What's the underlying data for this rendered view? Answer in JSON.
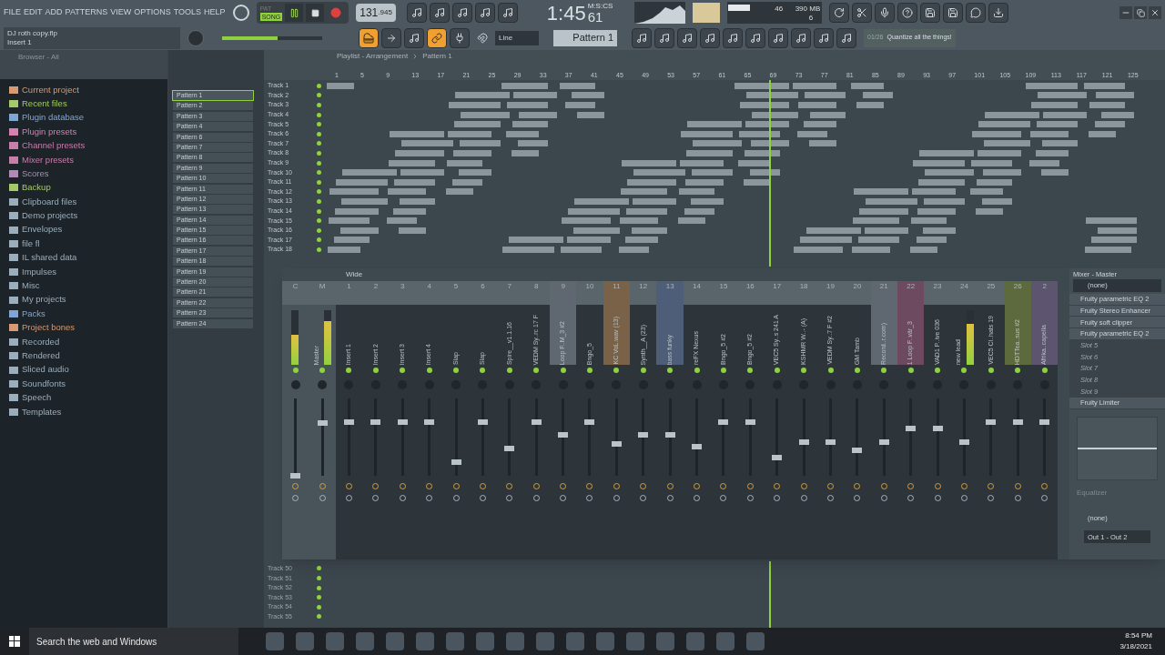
{
  "menu": [
    "FILE",
    "EDIT",
    "ADD",
    "PATTERNS",
    "VIEW",
    "OPTIONS",
    "TOOLS",
    "HELP"
  ],
  "project": {
    "file": "DJ roth copy.flp",
    "hint": "Insert 1"
  },
  "transport": {
    "mode_pat": "PAT",
    "mode_song": "SONG",
    "song_selected": true,
    "playing": true,
    "tempo": "131",
    "tempo_frac": ".945",
    "time": "1:45",
    "time_cs": "61",
    "time_unit": "M:S:CS",
    "main_volume": {
      "level": 0.55
    }
  },
  "cpu": {
    "value": "46",
    "memory": "390 MB",
    "voices": "6"
  },
  "snap": "Line",
  "pattern": "Pattern 1",
  "hint_bar": {
    "counter": "01/26",
    "text": "Quantize all the things!"
  },
  "browser": {
    "title": "Browser - All",
    "items": [
      {
        "label": "Current project",
        "color": "#d79a72"
      },
      {
        "label": "Recent files",
        "color": "#a6c96a"
      },
      {
        "label": "Plugin database",
        "color": "#7fa5d6"
      },
      {
        "label": "Plugin presets",
        "color": "#d77fb0"
      },
      {
        "label": "Channel presets",
        "color": "#c77faa"
      },
      {
        "label": "Mixer presets",
        "color": "#c77faa"
      },
      {
        "label": "Scores",
        "color": "#b18ab8"
      },
      {
        "label": "Backup",
        "color": "#a6c96a"
      },
      {
        "label": "Clipboard files",
        "color": "#9aaebb"
      },
      {
        "label": "Demo projects",
        "color": "#9aaebb"
      },
      {
        "label": "Envelopes",
        "color": "#9aaebb"
      },
      {
        "label": "file fl",
        "color": "#9aaebb"
      },
      {
        "label": "IL shared data",
        "color": "#9aaebb"
      },
      {
        "label": "Impulses",
        "color": "#9aaebb"
      },
      {
        "label": "Misc",
        "color": "#9aaebb"
      },
      {
        "label": "My projects",
        "color": "#9aaebb"
      },
      {
        "label": "Packs",
        "color": "#7fa5d6"
      },
      {
        "label": "Project bones",
        "color": "#d79a72"
      },
      {
        "label": "Recorded",
        "color": "#9aaebb"
      },
      {
        "label": "Rendered",
        "color": "#9aaebb"
      },
      {
        "label": "Sliced audio",
        "color": "#9aaebb"
      },
      {
        "label": "Soundfonts",
        "color": "#9aaebb"
      },
      {
        "label": "Speech",
        "color": "#9aaebb"
      },
      {
        "label": "Templates",
        "color": "#9aaebb"
      }
    ]
  },
  "patterns": [
    {
      "label": "Pattern 1",
      "selected": true
    },
    {
      "label": "Pattern 2",
      "selected": false
    },
    {
      "label": "Pattern 3",
      "selected": false
    },
    {
      "label": "Pattern 4",
      "selected": false
    },
    {
      "label": "Pattern 6",
      "selected": false
    },
    {
      "label": "Pattern 7",
      "selected": false
    },
    {
      "label": "Pattern 8",
      "selected": false
    },
    {
      "label": "Pattern 9",
      "selected": false
    },
    {
      "label": "Pattern 10",
      "selected": false
    },
    {
      "label": "Pattern 11",
      "selected": false
    },
    {
      "label": "Pattern 12",
      "selected": false
    },
    {
      "label": "Pattern 13",
      "selected": false
    },
    {
      "label": "Pattern 14",
      "selected": false
    },
    {
      "label": "Pattern 15",
      "selected": false
    },
    {
      "label": "Pattern 16",
      "selected": false
    },
    {
      "label": "Pattern 17",
      "selected": false
    },
    {
      "label": "Pattern 18",
      "selected": false
    },
    {
      "label": "Pattern 19",
      "selected": false
    },
    {
      "label": "Pattern 20",
      "selected": false
    },
    {
      "label": "Pattern 21",
      "selected": false
    },
    {
      "label": "Pattern 22",
      "selected": false
    },
    {
      "label": "Pattern 23",
      "selected": false
    },
    {
      "label": "Pattern 24",
      "selected": false
    }
  ],
  "playlist": {
    "title": "Playlist - Arrangement",
    "pattern": "Pattern 1",
    "ruler": [
      "1",
      "5",
      "9",
      "13",
      "17",
      "21",
      "25",
      "29",
      "33",
      "37",
      "41",
      "45",
      "49",
      "53",
      "57",
      "61",
      "65",
      "69",
      "73",
      "77",
      "81",
      "85",
      "89",
      "93",
      "97",
      "101",
      "105",
      "109",
      "113",
      "117",
      "121",
      "125"
    ],
    "tracks": [
      "Track 1",
      "Track 2",
      "Track 3",
      "Track 4",
      "Track 5",
      "Track 6",
      "Track 7",
      "Track 8",
      "Track 9",
      "Track 10",
      "Track 11",
      "Track 12",
      "Track 13",
      "Track 14",
      "Track 15",
      "Track 16",
      "Track 17",
      "Track 18"
    ],
    "lower_tracks": [
      "Track 50",
      "Track 51",
      "Track 52",
      "Track 53",
      "Track 54",
      "Track 55"
    ]
  },
  "mixer": {
    "view": "Wide",
    "channels": [
      {
        "number": "C",
        "level": 0,
        "meter": {
          "level": 0.55
        }
      },
      {
        "number": "M",
        "name": "Master",
        "level": 0.68,
        "meter": {
          "level": 0.8
        }
      },
      {
        "number": "1",
        "name": "Insert 1",
        "level": 0.7
      },
      {
        "number": "2",
        "name": "Insert 2",
        "level": 0.7
      },
      {
        "number": "3",
        "name": "Insert 3",
        "level": 0.7
      },
      {
        "number": "4",
        "name": "Insert 4",
        "level": 0.7
      },
      {
        "number": "5",
        "name": "Slap",
        "level": 0.18
      },
      {
        "number": "6",
        "name": "Slap",
        "level": 0.7
      },
      {
        "number": "7",
        "name": "Spire__v1.1.16",
        "level": 0.35
      },
      {
        "number": "8",
        "name": "VEDM Sy..rc 17 F",
        "level": 0.7
      },
      {
        "number": "9",
        "name": "Loop F..M_3 #2",
        "level": 0.53,
        "color": "#5f6870"
      },
      {
        "number": "10",
        "name": "Bngo_5",
        "level": 0.7
      },
      {
        "number": "11",
        "name": "KC VoL.wav (13)",
        "level": 0.41,
        "color": "#7a6248"
      },
      {
        "number": "12",
        "name": "Synth__A (23)",
        "level": 0.53
      },
      {
        "number": "13",
        "name": "bass funky",
        "level": 0.53,
        "color": "#4e5d78"
      },
      {
        "number": "14",
        "name": "reFX Nexus",
        "level": 0.38
      },
      {
        "number": "15",
        "name": "Bngo_5 #2",
        "level": 0.7
      },
      {
        "number": "16",
        "name": "Bngo_5 #2",
        "level": 0.7
      },
      {
        "number": "17",
        "name": "VEC5 Sy..s 241 A",
        "level": 0.24
      },
      {
        "number": "18",
        "name": "KSHMR W..- (A)",
        "level": 0.44
      },
      {
        "number": "19",
        "name": "VEDM Sy..7 F #2",
        "level": 0.44
      },
      {
        "number": "20",
        "name": "GM Tamb",
        "level": 0.33
      },
      {
        "number": "21",
        "name": "Record..r.com)",
        "level": 0.44,
        "color": "#5f6870"
      },
      {
        "number": "22",
        "name": "1 Loop F..vär_3",
        "level": 0.61,
        "color": "#6e4a60"
      },
      {
        "number": "23",
        "name": "VAD1 P..ive 036",
        "level": 0.61
      },
      {
        "number": "24",
        "name": "new lead",
        "level": 0.44,
        "meter": {
          "level": 0.75
        }
      },
      {
        "number": "25",
        "name": "VEC5 Cl..hats 19",
        "level": 0.7
      },
      {
        "number": "26",
        "name": "HDTTea..sus #2",
        "level": 0.7,
        "color": "#5c6a3e"
      },
      {
        "number": "2",
        "name": "Afrika..capella",
        "level": 0.7,
        "color": "#5d5570"
      }
    ]
  },
  "mixer_panel": {
    "title": "Mixer - Master",
    "input": "(none)",
    "slots": [
      {
        "label": "Fruity parametric EQ 2",
        "disabled": false
      },
      {
        "label": "Fruity Stereo Enhancer",
        "disabled": false
      },
      {
        "label": "Fruity soft clipper",
        "disabled": false
      },
      {
        "label": "Fruity parametric EQ 2",
        "disabled": false
      },
      {
        "label": "Slot 5",
        "disabled": true
      },
      {
        "label": "Slot 6",
        "disabled": true
      },
      {
        "label": "Slot 7",
        "disabled": true
      },
      {
        "label": "Slot 8",
        "disabled": true
      },
      {
        "label": "Slot 9",
        "disabled": true
      },
      {
        "label": "Fruity Limiter",
        "disabled": false
      }
    ],
    "eq_label": "Equalizer",
    "sidechain": "(none)",
    "output": "Out 1 - Out 2"
  },
  "taskbar": {
    "search": "Search the web and Windows",
    "time": "8:54 PM",
    "date": "3/18/2021"
  }
}
